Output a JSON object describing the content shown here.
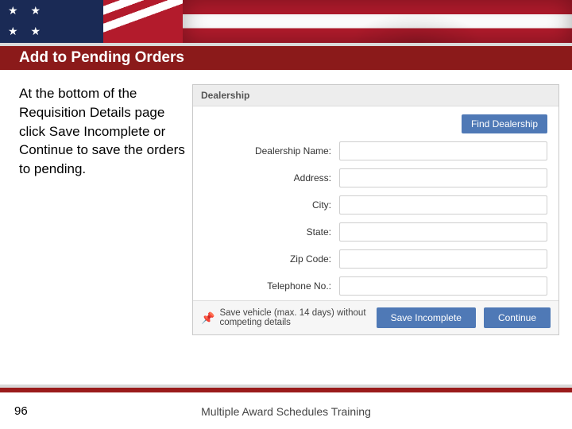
{
  "header": {
    "title": "Add to Pending Orders"
  },
  "intro": {
    "text": "At the bottom of the Requisition Details page click Save Incomplete or Continue to save the orders to pending."
  },
  "app": {
    "section_title": "Dealership",
    "find_button": "Find Dealership",
    "fields": {
      "name": {
        "label": "Dealership Name:",
        "value": ""
      },
      "addr": {
        "label": "Address:",
        "value": ""
      },
      "city": {
        "label": "City:",
        "value": ""
      },
      "state": {
        "label": "State:",
        "value": ""
      },
      "zip": {
        "label": "Zip Code:",
        "value": ""
      },
      "phone": {
        "label": "Telephone No.:",
        "value": ""
      }
    },
    "footer_note": "Save vehicle (max. 14 days) without competing details",
    "save_button": "Save Incomplete",
    "continue_button": "Continue"
  },
  "footer": {
    "page_number": "96",
    "training_label": "Multiple Award Schedules Training"
  }
}
